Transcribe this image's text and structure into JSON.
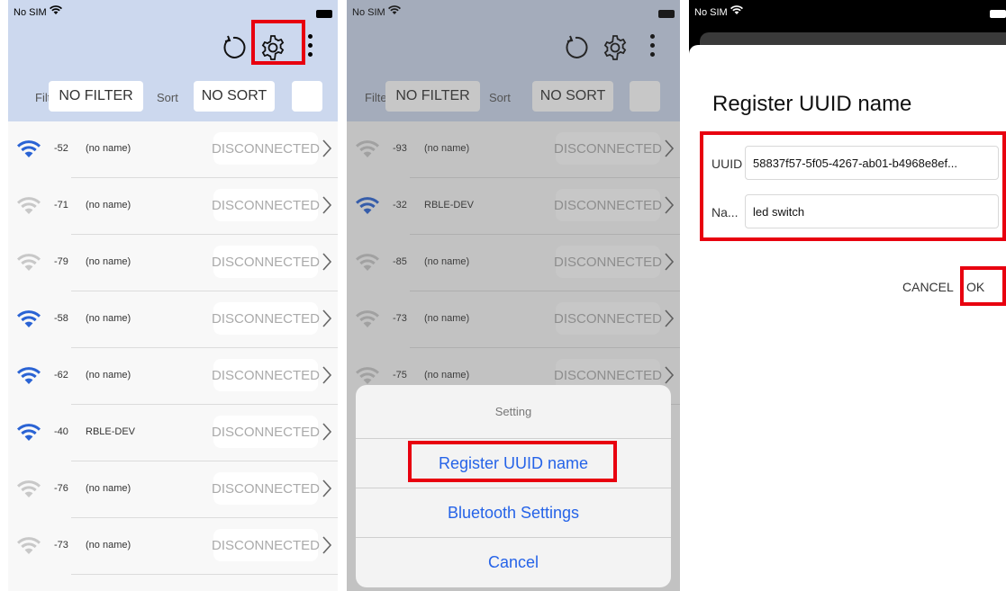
{
  "status": {
    "carrier": "No SIM"
  },
  "list_header": {
    "filter_label": "Filte",
    "filter_value": "NO FILTER",
    "sort_label": "Sort",
    "sort_value": "NO SORT"
  },
  "panel1_devices": [
    {
      "rssi": "-52",
      "name": "(no name)",
      "state": "DISCONNECTED",
      "strong": true
    },
    {
      "rssi": "-71",
      "name": "(no name)",
      "state": "DISCONNECTED",
      "strong": false
    },
    {
      "rssi": "-79",
      "name": "(no name)",
      "state": "DISCONNECTED",
      "strong": false
    },
    {
      "rssi": "-58",
      "name": "(no name)",
      "state": "DISCONNECTED",
      "strong": true
    },
    {
      "rssi": "-62",
      "name": "(no name)",
      "state": "DISCONNECTED",
      "strong": true
    },
    {
      "rssi": "-40",
      "name": "RBLE-DEV",
      "state": "DISCONNECTED",
      "strong": true
    },
    {
      "rssi": "-76",
      "name": "(no name)",
      "state": "DISCONNECTED",
      "strong": false
    },
    {
      "rssi": "-73",
      "name": "(no name)",
      "state": "DISCONNECTED",
      "strong": false
    }
  ],
  "panel2_devices": [
    {
      "rssi": "-93",
      "name": "(no name)",
      "state": "DISCONNECTED",
      "strong": false
    },
    {
      "rssi": "-32",
      "name": "RBLE-DEV",
      "state": "DISCONNECTED",
      "strong": true
    },
    {
      "rssi": "-85",
      "name": "(no name)",
      "state": "DISCONNECTED",
      "strong": false
    },
    {
      "rssi": "-73",
      "name": "(no name)",
      "state": "DISCONNECTED",
      "strong": false
    },
    {
      "rssi": "-75",
      "name": "(no name)",
      "state": "DISCONNECTED",
      "strong": false
    }
  ],
  "action_sheet": {
    "title": "Setting",
    "items": [
      "Register UUID name",
      "Bluetooth Settings",
      "Cancel"
    ]
  },
  "dialog": {
    "title": "Register UUID name",
    "uuid_label": "UUID",
    "uuid_value": "58837f57-5f05-4267-ab01-b4968e8ef...",
    "name_label": "Na...",
    "name_value": "led switch",
    "cancel_label": "CANCEL",
    "ok_label": "OK"
  },
  "colors": {
    "header": "#ccd8ee",
    "accent": "#2563e8",
    "highlight": "#e8000f",
    "wifi_strong": "#2a63d4",
    "wifi_weak": "#c8c8c8"
  }
}
